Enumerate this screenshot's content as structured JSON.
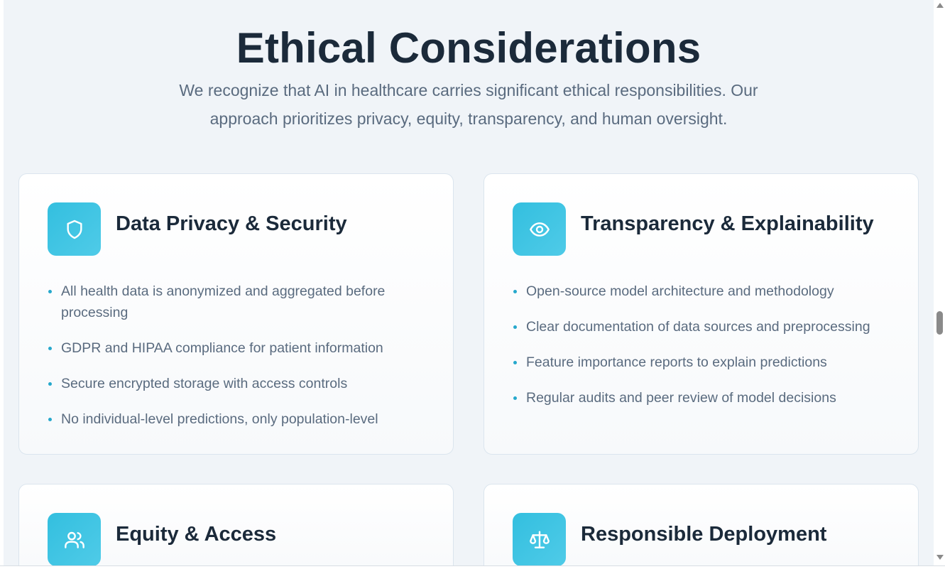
{
  "header": {
    "title": "Ethical Considerations",
    "subtitle": "We recognize that AI in healthcare carries significant ethical responsibilities. Our approach prioritizes privacy, equity, transparency, and human oversight."
  },
  "cards": [
    {
      "title": "Data Privacy & Security",
      "icon": "shield-icon",
      "bullets": [
        "All health data is anonymized and aggregated before processing",
        "GDPR and HIPAA compliance for patient information",
        "Secure encrypted storage with access controls",
        "No individual-level predictions, only population-level"
      ]
    },
    {
      "title": "Transparency & Explainability",
      "icon": "eye-icon",
      "bullets": [
        "Open-source model architecture and methodology",
        "Clear documentation of data sources and preprocessing",
        "Feature importance reports to explain predictions",
        "Regular audits and peer review of model decisions"
      ]
    },
    {
      "title": "Equity & Access",
      "icon": "users-icon",
      "bullets": []
    },
    {
      "title": "Responsible Deployment",
      "icon": "scale-icon",
      "bullets": []
    }
  ],
  "colors": {
    "accent": "#33bfdf",
    "bullet_dot": "#26a8cc",
    "title_text": "#1b2a3a",
    "body_text": "#5a6b7f",
    "page_background": "#f0f4f8"
  }
}
